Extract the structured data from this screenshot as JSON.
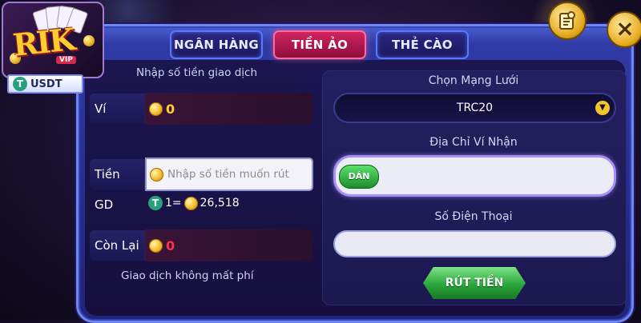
{
  "tabs": [
    {
      "label": "NGÂN HÀNG",
      "active": false
    },
    {
      "label": "TIỀN ẢO",
      "active": true
    },
    {
      "label": "THẺ CÀO",
      "active": false
    }
  ],
  "logo": {
    "text": "RIK",
    "badge": "VIP"
  },
  "currency_badge": {
    "icon": "tether-icon",
    "label": "USDT"
  },
  "left": {
    "caption_top": "Nhập số tiền giao dịch",
    "wallet": {
      "label": "Ví",
      "value": "0"
    },
    "amount": {
      "label": "Tiền GD",
      "placeholder": "Nhập số tiền muốn rút"
    },
    "rate": {
      "lhs": "1=",
      "value": "26,518"
    },
    "remaining": {
      "label": "Còn Lại",
      "value": "0"
    },
    "caption_bottom": "Giao dịch không mất phí"
  },
  "right": {
    "network_caption": "Chọn Mạng Lưới",
    "network_selected": "TRC20",
    "address_caption": "Địa Chỉ Ví Nhận",
    "paste_label": "DÁN",
    "phone_caption": "Số Điện Thoại",
    "withdraw_label": "RÚT TIỀN"
  },
  "icons": {
    "close": "×",
    "tether": "T",
    "caret": "▼"
  },
  "colors": {
    "accent_red": "#ff3048",
    "coin_yellow": "#ffcf36",
    "active_tab": "#c11d55"
  }
}
